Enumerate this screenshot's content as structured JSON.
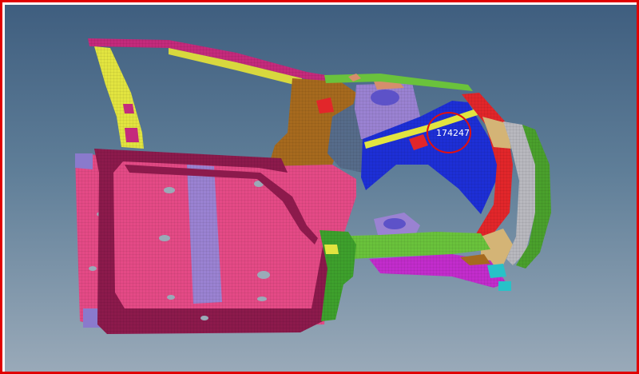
{
  "viewport": {
    "node_label": "174247",
    "colors": {
      "frame_border": "#e00000",
      "background_top": "#3f5e7f",
      "background_bottom": "#9aaab9",
      "highlight": "#e01010"
    }
  }
}
